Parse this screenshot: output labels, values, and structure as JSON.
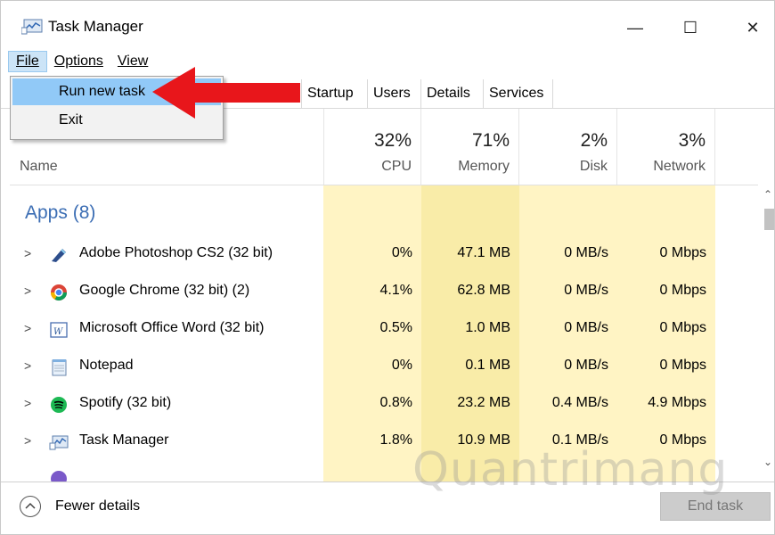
{
  "window": {
    "title": "Task Manager"
  },
  "window_controls": {
    "minimize": "—",
    "maximize": "☐",
    "close": "✕"
  },
  "menu": {
    "file": "File",
    "options": "Options",
    "view": "View"
  },
  "dropdown": {
    "run_new_task": "Run new task",
    "exit": "Exit"
  },
  "tabs": {
    "startup": "Startup",
    "users": "Users",
    "details": "Details",
    "services": "Services"
  },
  "columns": {
    "name": "Name",
    "cpu": {
      "pct": "32%",
      "label": "CPU"
    },
    "memory": {
      "pct": "71%",
      "label": "Memory"
    },
    "disk": {
      "pct": "2%",
      "label": "Disk"
    },
    "network": {
      "pct": "3%",
      "label": "Network"
    }
  },
  "apps_group": {
    "title": "Apps (8)"
  },
  "rows": [
    {
      "name": "Adobe Photoshop CS2 (32 bit)",
      "cpu": "0%",
      "memory": "47.1 MB",
      "disk": "0 MB/s",
      "network": "0 Mbps",
      "icon": "photoshop-icon"
    },
    {
      "name": "Google Chrome (32 bit) (2)",
      "cpu": "4.1%",
      "memory": "62.8 MB",
      "disk": "0 MB/s",
      "network": "0 Mbps",
      "icon": "chrome-icon"
    },
    {
      "name": "Microsoft Office Word (32 bit)",
      "cpu": "0.5%",
      "memory": "1.0 MB",
      "disk": "0 MB/s",
      "network": "0 Mbps",
      "icon": "word-icon"
    },
    {
      "name": "Notepad",
      "cpu": "0%",
      "memory": "0.1 MB",
      "disk": "0 MB/s",
      "network": "0 Mbps",
      "icon": "notepad-icon"
    },
    {
      "name": "Spotify (32 bit)",
      "cpu": "0.8%",
      "memory": "23.2 MB",
      "disk": "0.4 MB/s",
      "network": "4.9 Mbps",
      "icon": "spotify-icon"
    },
    {
      "name": "Task Manager",
      "cpu": "1.8%",
      "memory": "10.9 MB",
      "disk": "0.1 MB/s",
      "network": "0 Mbps",
      "icon": "task-manager-icon"
    }
  ],
  "footer": {
    "fewer_details": "Fewer details",
    "end_task": "End task"
  },
  "watermark": "Quantrimang",
  "colors": {
    "cpu_bg": "#fff4c4",
    "memory_bg": "#f9eca8",
    "disk_bg": "#fff4c4",
    "network_bg": "#fff4c4",
    "accent": "#3c6eb4",
    "menu_highlight": "#91c9f7",
    "arrow": "#e8161b"
  }
}
